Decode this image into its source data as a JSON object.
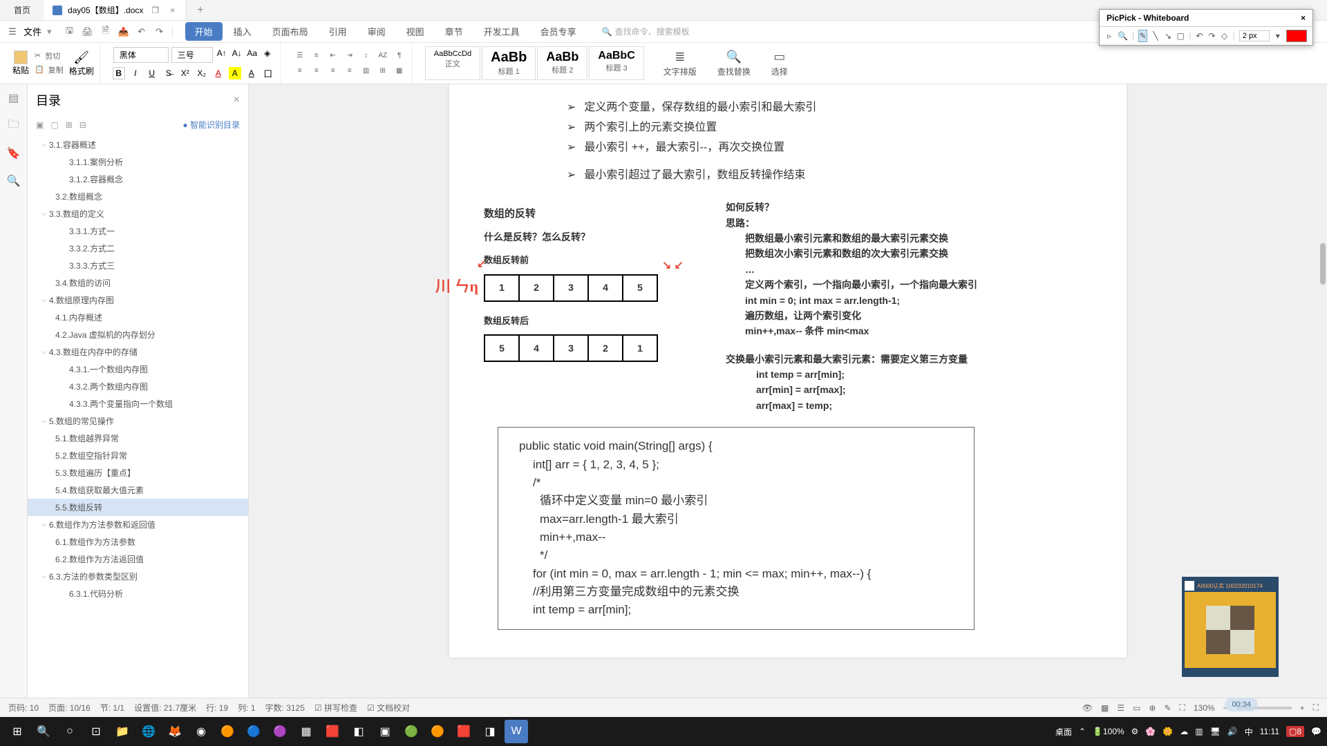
{
  "titlebar": {
    "home": "首页",
    "doc_name": "day05【数组】.docx",
    "close": "×",
    "restore": "❐",
    "add": "+"
  },
  "menubar": {
    "file": "文件",
    "tabs": [
      "开始",
      "插入",
      "页面布局",
      "引用",
      "审阅",
      "视图",
      "章节",
      "开发工具",
      "会员专享"
    ],
    "search_placeholder": "查找命令、搜索模板"
  },
  "ribbon": {
    "paste": "粘贴",
    "cut": "剪切",
    "copy": "复制",
    "format_painter": "格式刷",
    "font_name": "黑体",
    "font_size": "三号",
    "styles": [
      {
        "preview": "AaBbCcDd",
        "label": "正文"
      },
      {
        "preview": "AaBb",
        "label": "标题 1"
      },
      {
        "preview": "AaBb",
        "label": "标题 2"
      },
      {
        "preview": "AaBbC",
        "label": "标题 3"
      }
    ],
    "wrap": "文字排版",
    "findreplace": "查找替换",
    "select": "选择"
  },
  "outline": {
    "title": "目录",
    "smart": "智能识别目录",
    "items": [
      {
        "text": "3.1.容器概述",
        "level": 1,
        "expandable": true
      },
      {
        "text": "3.1.1.案例分析",
        "level": 3
      },
      {
        "text": "3.1.2.容器概念",
        "level": 3
      },
      {
        "text": "3.2.数组概念",
        "level": 2
      },
      {
        "text": "3.3.数组的定义",
        "level": 1,
        "expandable": true
      },
      {
        "text": "3.3.1.方式一",
        "level": 3
      },
      {
        "text": "3.3.2.方式二",
        "level": 3
      },
      {
        "text": "3.3.3.方式三",
        "level": 3
      },
      {
        "text": "3.4.数组的访问",
        "level": 2
      },
      {
        "text": "4.数组原理内存图",
        "level": 1,
        "expandable": true
      },
      {
        "text": "4.1.内存概述",
        "level": 2
      },
      {
        "text": "4.2.Java 虚拟机的内存划分",
        "level": 2
      },
      {
        "text": "4.3.数组在内存中的存储",
        "level": 1,
        "expandable": true
      },
      {
        "text": "4.3.1.一个数组内存图",
        "level": 3
      },
      {
        "text": "4.3.2.两个数组内存图",
        "level": 3
      },
      {
        "text": "4.3.3.两个变量指向一个数组",
        "level": 3
      },
      {
        "text": "5.数组的常见操作",
        "level": 1,
        "expandable": true
      },
      {
        "text": "5.1.数组越界异常",
        "level": 2
      },
      {
        "text": "5.2.数组空指针异常",
        "level": 2
      },
      {
        "text": "5.3.数组遍历【重点】",
        "level": 2
      },
      {
        "text": "5.4.数组获取最大值元素",
        "level": 2
      },
      {
        "text": "5.5.数组反转",
        "level": 2,
        "active": true
      },
      {
        "text": "6.数组作为方法参数和返回值",
        "level": 1,
        "expandable": true
      },
      {
        "text": "6.1.数组作为方法参数",
        "level": 2
      },
      {
        "text": "6.2.数组作为方法返回值",
        "level": 2
      },
      {
        "text": "6.3.方法的参数类型区别",
        "level": 1,
        "expandable": true
      },
      {
        "text": "6.3.1.代码分析",
        "level": 3
      }
    ]
  },
  "doc": {
    "bullets": [
      "定义两个变量，保存数组的最小索引和最大索引",
      "两个索引上的元素交换位置",
      "最小索引 ++，最大索引--，再次交换位置",
      "最小索引超过了最大索引，数组反转操作结束"
    ],
    "img_left": {
      "title_main": "数组的反转",
      "title_q": "什么是反转？怎么反转？",
      "title_before": "数组反转前",
      "title_after": "数组反转后",
      "arr_before": [
        "1",
        "2",
        "3",
        "4",
        "5"
      ],
      "arr_after": [
        "5",
        "4",
        "3",
        "2",
        "1"
      ]
    },
    "img_right": {
      "t1": "如何反转？",
      "t2": "思路：",
      "lines": [
        "把数组最小索引元素和数组的最大索引元素交换",
        "把数组次小索引元素和数组的次大索引元素交换",
        "…",
        "定义两个索引，一个指向最小索引，一个指向最大索引",
        "int min = 0; int max = arr.length-1;",
        "遍历数组，让两个索引变化",
        "min++,max-- 条件 min<max"
      ],
      "swap_title": "交换最小索引元素和最大索引元素：需要定义第三方变量",
      "swap": [
        "int temp = arr[min];",
        "arr[min] = arr[max];",
        "arr[max] = temp;"
      ]
    },
    "code": [
      "public static void main(String[] args) {",
      "    int[] arr = { 1, 2, 3, 4, 5 };",
      "    /*",
      "     循环中定义变量 min=0 最小索引",
      "     max=arr.length-1 最大索引",
      "     min++,max--",
      "     */",
      "    for (int min = 0, max = arr.length - 1; min <= max; min++, max--) {",
      "    //利用第三方变量完成数组中的元素交换",
      "    int temp = arr[min];"
    ]
  },
  "statusbar": {
    "items": [
      "页码: 10",
      "页面: 10/16",
      "节: 1/1",
      "设置值: 21.7厘米",
      "行: 19",
      "列: 1",
      "字数: 3125"
    ],
    "spell": "拼写检查",
    "proof": "文档校对",
    "zoom": "130%"
  },
  "picpick": {
    "title": "PicPick - Whiteboard",
    "size": "2 px"
  },
  "taskbar": {
    "desktop": "桌面",
    "battery": "100%",
    "time": "11:11",
    "notif": "8"
  },
  "qr": {
    "head": "A0000认实 100232010174"
  },
  "timer": "00:34"
}
